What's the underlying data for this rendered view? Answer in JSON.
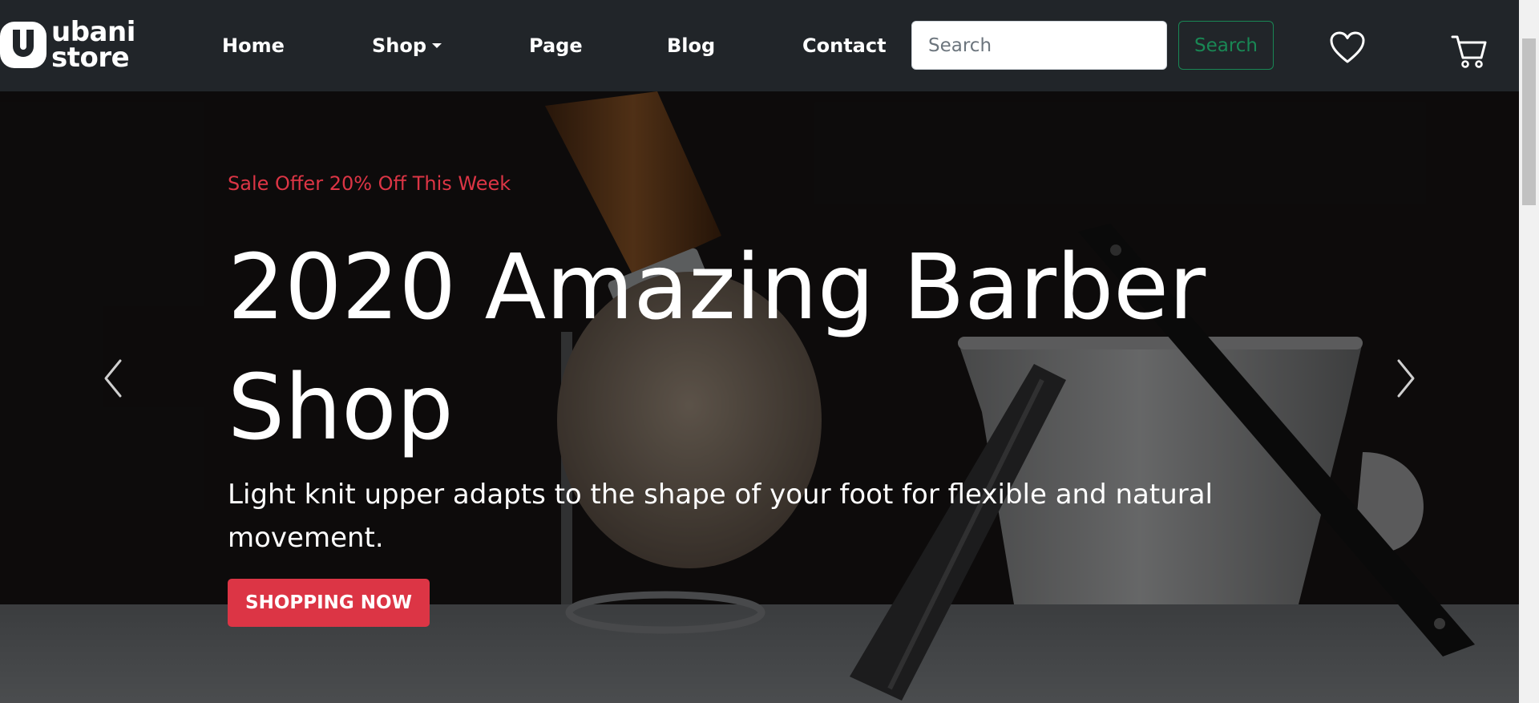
{
  "brand": {
    "name_line1": "ubani",
    "name_line2": "store",
    "logo_icon": "u-logo-icon"
  },
  "nav": {
    "items": [
      {
        "label": "Home"
      },
      {
        "label": "Shop",
        "dropdown": true
      },
      {
        "label": "Page"
      },
      {
        "label": "Blog"
      },
      {
        "label": "Contact"
      }
    ]
  },
  "search": {
    "placeholder": "Search",
    "value": "",
    "button_label": "Search"
  },
  "icons": {
    "wishlist": "heart-icon",
    "cart": "cart-icon",
    "prev": "chevron-left-icon",
    "next": "chevron-right-icon"
  },
  "hero": {
    "subtitle": "Sale Offer 20% Off This Week",
    "title": "2020 Amazing Barber Shop",
    "text": "Light knit upper adapts to the shape of your foot for flexible and natural movement.",
    "cta_label": "SHOPPING NOW"
  },
  "colors": {
    "navbar_bg": "#212529",
    "accent_red": "#dc3545",
    "search_green": "#198754"
  }
}
